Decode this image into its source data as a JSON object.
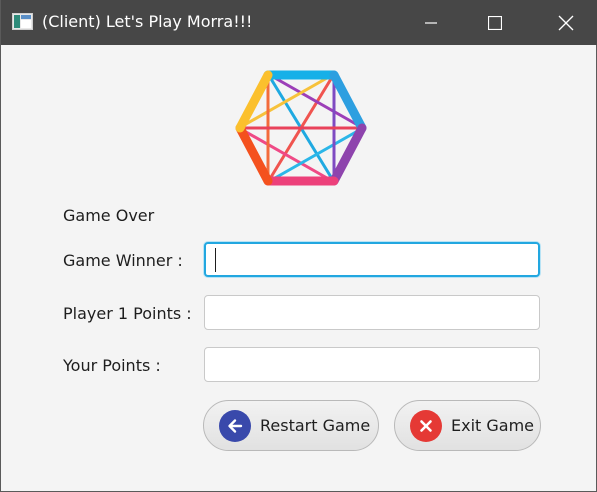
{
  "window": {
    "title": "(Client) Let's Play Morra!!!"
  },
  "icons": {
    "app": "app-window-icon",
    "logo": "hexagon-logo",
    "minimize": "minimize-icon",
    "maximize": "maximize-icon",
    "close": "close-icon",
    "restart": "arrow-left-icon",
    "exit": "x-circle-icon"
  },
  "form": {
    "status": "Game Over",
    "winner_label": "Game Winner :",
    "winner_value": "",
    "player1_label": "Player 1 Points :",
    "player1_value": "",
    "your_points_label": "Your Points :",
    "your_points_value": ""
  },
  "buttons": {
    "restart_label": "Restart Game",
    "exit_label": "Exit Game"
  },
  "colors": {
    "titlebar": "#474747",
    "focus": "#22a7e0",
    "restart_icon": "#3949ab",
    "exit_icon": "#e53935"
  }
}
